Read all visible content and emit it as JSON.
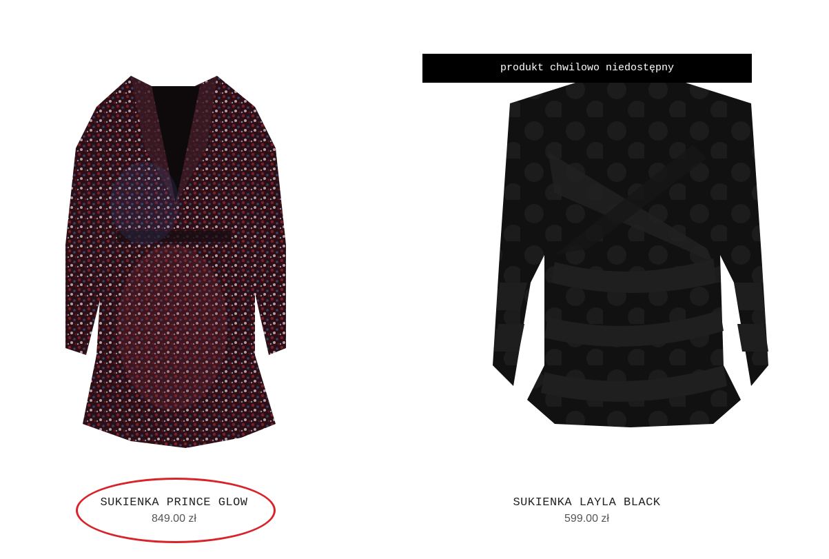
{
  "products": [
    {
      "name": "SUKIENKA PRINCE GLOW",
      "price": "849.00 zł",
      "image_icon": "sequin-blazer-dress-image",
      "highlighted": true
    },
    {
      "name": "SUKIENKA LAYLA BLACK",
      "price": "599.00 zł",
      "image_icon": "black-wrap-dress-image",
      "badge": "produkt chwilowo niedostępny"
    }
  ],
  "colors": {
    "highlight": "#d8232a",
    "badge_bg": "#000000",
    "badge_text": "#ffffff"
  }
}
